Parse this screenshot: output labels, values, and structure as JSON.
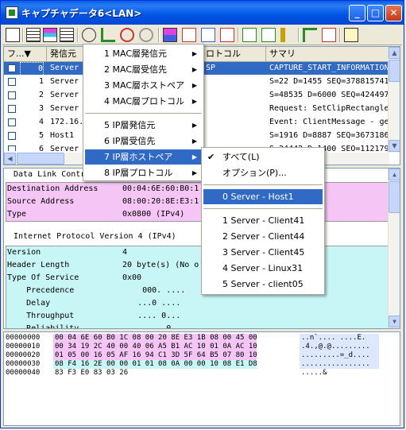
{
  "window": {
    "title": "キャプチャデータ6<LAN>",
    "min_label": "_",
    "max_label": "□",
    "close_label": "✕"
  },
  "toolbar_icons": [
    "grid-toggle-icon",
    "table-icon",
    "color-table-icon",
    "table-alt-icon",
    "circle-down-icon",
    "download-icon",
    "refresh-icon",
    "gear-icon",
    "color-bar-icon",
    "swap-icon",
    "chart-icon",
    "chart-delete-icon",
    "monitor-icon",
    "monitor-alt-icon",
    "speaker-icon",
    "filter-icon",
    "filter-alt-icon",
    "note-icon"
  ],
  "list": {
    "columns": [
      "フ...▼",
      "発信元",
      "",
      "ロトコル",
      "サマリ"
    ],
    "rows": [
      {
        "num": "0",
        "src": "Server",
        "proto": "SP",
        "summary": "CAPTURE_START_INFORMATION"
      },
      {
        "num": "1",
        "src": "Server",
        "proto": "",
        "summary": "S=22 D=1455 SEQ=378815741"
      },
      {
        "num": "2",
        "src": "Server",
        "proto": "",
        "summary": "S=48535 D=6000 SEQ=424497"
      },
      {
        "num": "3",
        "src": "Server",
        "proto": "",
        "summary": "Request: SetClipRectangle"
      },
      {
        "num": "4",
        "src": "172.16.",
        "proto": "",
        "summary": "Event: ClientMessage - ge"
      },
      {
        "num": "5",
        "src": "Host1",
        "proto": "",
        "summary": "S=1916 D=8887 SEQ=3673186"
      },
      {
        "num": "6",
        "src": "Server",
        "proto": "",
        "summary": "S=24442 D=1400 SEQ=112179"
      }
    ]
  },
  "detail": {
    "section1": "Data Link Contr",
    "rows1": [
      {
        "k": "Destination Address",
        "v": "00:04:6E:60:B0:1"
      },
      {
        "k": "Source Address",
        "v": "08:00:20:8E:E3:1"
      },
      {
        "k": "Type",
        "v": "0x0800 (IPv4)"
      }
    ],
    "section2": "Internet Protocol Version 4 (IPv4)",
    "rows2": [
      {
        "k": "Version",
        "v": "4"
      },
      {
        "k": "Header Length",
        "v": "20 byte(s) (No o"
      },
      {
        "k": "Type Of Service",
        "v": "0x00"
      },
      {
        "k": "    Precedence",
        "v": "     000. ...."
      },
      {
        "k": "    Delay",
        "v": "    ...0 ...."
      },
      {
        "k": "    Throughput",
        "v": "    .... 0..."
      },
      {
        "k": "    Reliability",
        "v": "    .... .0.."
      }
    ]
  },
  "hex": {
    "rows": [
      {
        "off": "00000000",
        "bytes": "00 04 6E 60 B0 1C 08 00 20 8E E3 1B 08 00 45 00",
        "ascii": "..n`.... ....E."
      },
      {
        "off": "00000010",
        "bytes": "00 34 19 2C 40 00 40 06 A5 B1 AC 10 01 0A AC 10",
        "ascii": ".4.,@.@........."
      },
      {
        "off": "00000020",
        "bytes": "01 05 00 16 05 AF 16 94 C1 3D 5F 64 B5 07 80 10",
        "ascii": ".........=_d...."
      },
      {
        "off": "00000030",
        "bytes": "08 F4 16 2E 00 00 01 01 08 0A 00 00 10 08 E1 D8",
        "ascii": "................"
      },
      {
        "off": "00000040",
        "bytes": "83 F3 E0 83 03 26",
        "ascii": ".....&"
      }
    ]
  },
  "menu1": {
    "items": [
      {
        "label": "1 MAC層発信元"
      },
      {
        "label": "2 MAC層受信先"
      },
      {
        "label": "3 MAC層ホストペア"
      },
      {
        "label": "4 MAC層プロトコル"
      },
      {
        "label": "5 IP層発信元"
      },
      {
        "label": "6 IP層受信先"
      },
      {
        "label": "7 IP層ホストペア"
      },
      {
        "label": "8 IP層プロトコル"
      }
    ]
  },
  "menu2": {
    "items": [
      {
        "label": "すべて(L)",
        "checked": "✔"
      },
      {
        "label": "オプション(P)..."
      },
      {
        "label": "0 Server - Host1"
      },
      {
        "label": "1 Server - Client41"
      },
      {
        "label": "2 Server - Client44"
      },
      {
        "label": "3 Server - Client45"
      },
      {
        "label": "4 Server - Linux31"
      },
      {
        "label": "5 Server - client05"
      }
    ]
  },
  "colors": {
    "accent": "#316ac5",
    "pink": "#f5c6f5",
    "cyan": "#c8f5f5"
  }
}
